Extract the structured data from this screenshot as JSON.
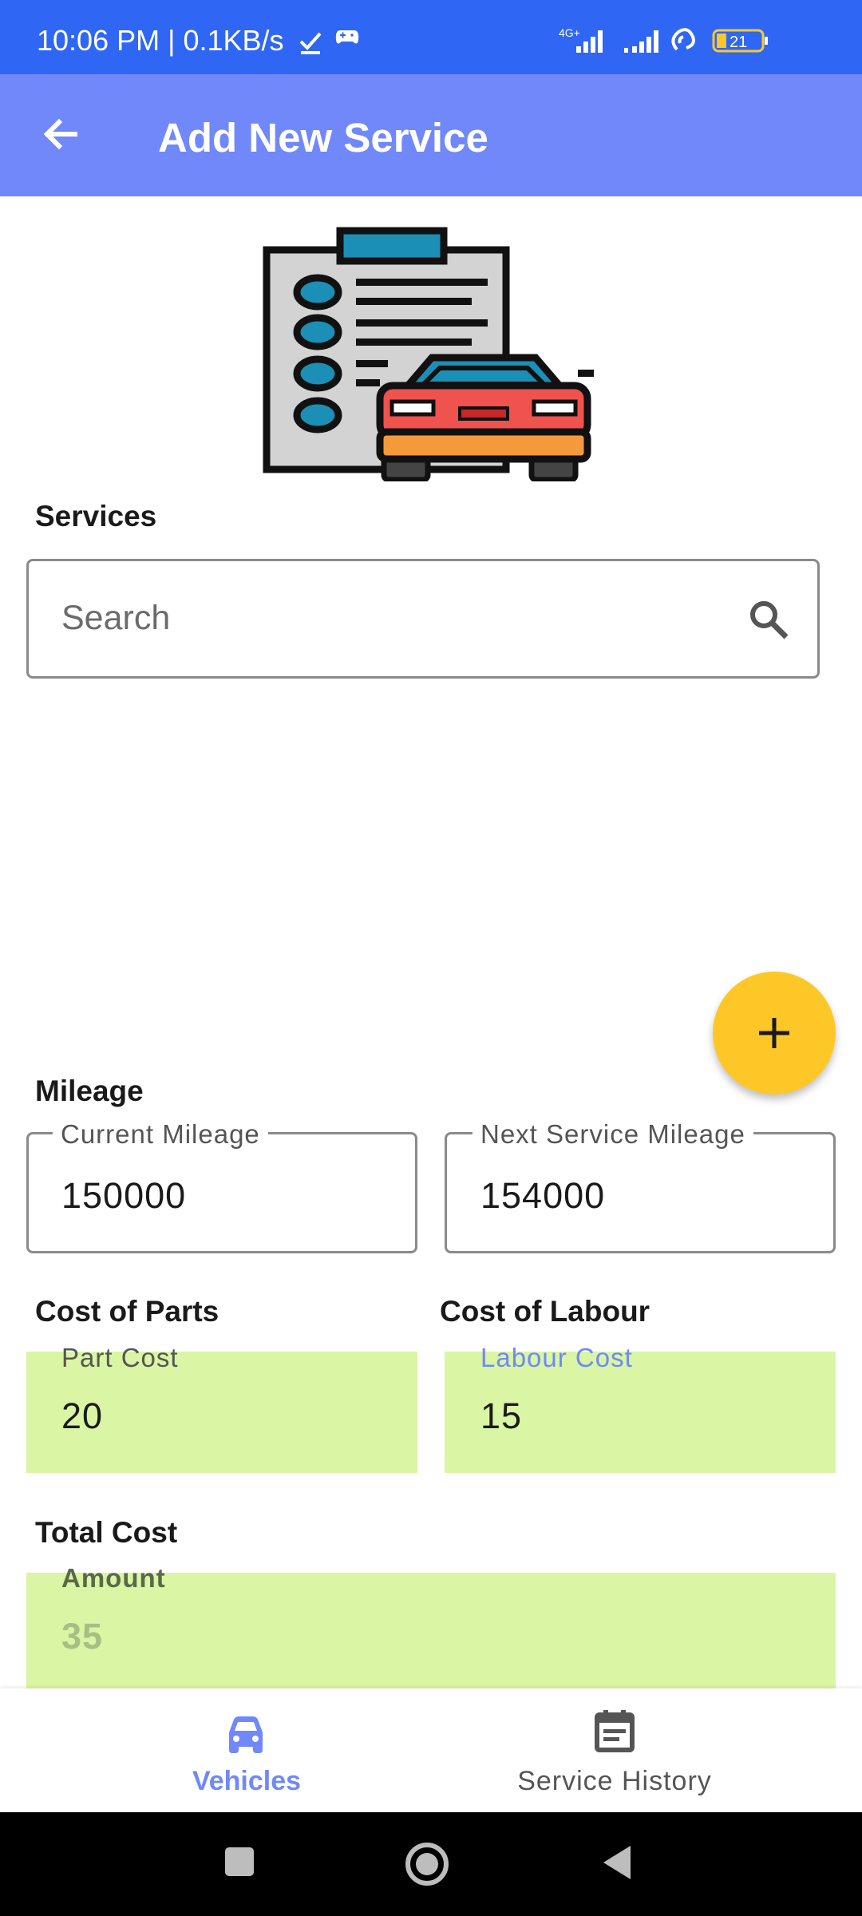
{
  "status_bar": {
    "time_speed": "10:06 PM | 0.1KB/s",
    "network_label": "4G+",
    "battery_level": "21"
  },
  "app_bar": {
    "title": "Add New Service",
    "back_icon": "arrow-back-icon"
  },
  "services": {
    "section_label": "Services",
    "search_placeholder": "Search",
    "search_icon": "search-icon"
  },
  "fab": {
    "icon": "plus-icon",
    "color": "#fdc827"
  },
  "mileage": {
    "section_label": "Mileage",
    "current": {
      "label": "Current Mileage",
      "value": "150000"
    },
    "next": {
      "label": "Next Service Mileage",
      "value": "154000"
    }
  },
  "costs": {
    "parts_section_label": "Cost of Parts",
    "labour_section_label": "Cost of Labour",
    "part_cost": {
      "label": "Part Cost",
      "value": "20"
    },
    "labour_cost": {
      "label": "Labour Cost",
      "value": "15"
    }
  },
  "total": {
    "section_label": "Total Cost",
    "amount_label": "Amount",
    "amount_value": "35"
  },
  "bottom_nav": {
    "items": [
      {
        "label": "Vehicles",
        "icon": "car-icon",
        "active": true
      },
      {
        "label": "Service History",
        "icon": "calendar-list-icon",
        "active": false
      }
    ]
  },
  "colors": {
    "status_bar": "#2f66f4",
    "app_bar": "#7088fa",
    "accent": "#7088fa",
    "filled_field": "#daf5a3",
    "fab": "#fdc827"
  }
}
